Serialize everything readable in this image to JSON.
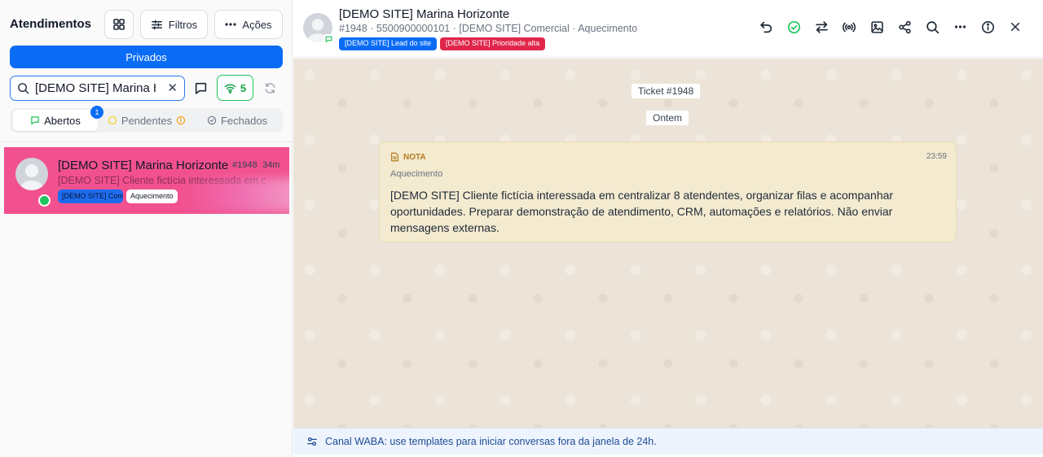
{
  "sidebar": {
    "title": "Atendimentos",
    "filters_label": "Filtros",
    "actions_label": "Ações",
    "privados_label": "Privados",
    "search": {
      "value": "[DEMO SITE] Marina Horizonte"
    },
    "connection_count": "5",
    "tabs": [
      {
        "label": "Abertos",
        "badge": "1",
        "active": true
      },
      {
        "label": "Pendentes",
        "active": false
      },
      {
        "label": "Fechados",
        "active": false
      }
    ],
    "ticket": {
      "name": "[DEMO SITE] Marina Horizonte",
      "id": "#1948",
      "time": "34m",
      "preview": "[DEMO SITE] Cliente fictícia interessada em c",
      "tag1": "[DEMO SITE] Comercial",
      "tag2": "Aquecimento"
    }
  },
  "header": {
    "name": "[DEMO SITE] Marina Horizonte",
    "meta": "#1948 · 5500900000101 · [DEMO SITE] Comercial · Aquecimento",
    "tags": [
      "[DEMO SITE] Lead do site",
      "[DEMO SITE] Prioridade alta"
    ]
  },
  "chat": {
    "ticket_pill": "Ticket #1948",
    "date_pill": "Ontem",
    "note": {
      "label": "NOTA",
      "time": "23:59",
      "subtitle": "Aquecimento",
      "text": "[DEMO SITE] Cliente fictícia interessada em centralizar 8 atendentes, organizar filas e acompanhar oportunidades. Preparar demonstração de atendimento, CRM, automações e relatórios. Não enviar mensagens externas."
    }
  },
  "footer": {
    "text": "Canal WABA: use templates para iniciar conversas fora da janela de 24h."
  },
  "colors": {
    "primary": "#0a6cf5",
    "ticket_highlight": "#f2518f",
    "tag_red": "#e0264a",
    "whatsapp_green": "#22c55e",
    "note_bg": "#f3ead0",
    "chat_bg": "#ece4d8"
  }
}
